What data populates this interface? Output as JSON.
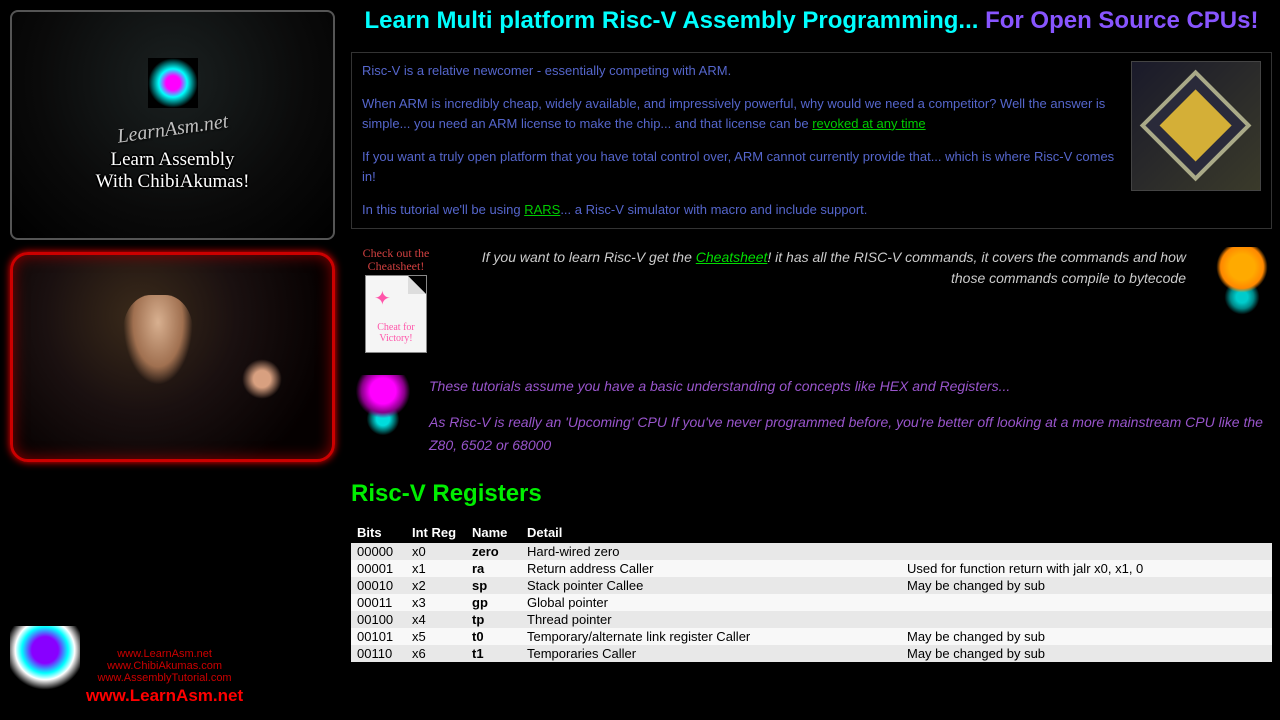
{
  "sidebar": {
    "logo_brand": "LearnAsm.net",
    "logo_tagline_1": "Learn Assembly",
    "logo_tagline_2": "With ChibiAkumas!",
    "footer_links": [
      "www.LearnAsm.net",
      "www.ChibiAkumas.com",
      "www.AssemblyTutorial.com"
    ],
    "footer_main": "www.LearnAsm.net"
  },
  "title": {
    "part1": "Learn Multi platform Risc-V Assembly Programming... ",
    "part2": "For Open Source CPUs!"
  },
  "intro": {
    "p1": "Risc-V is a relative newcomer - essentially competing with ARM.",
    "p2a": "When ARM is incredibly cheap, widely available, and impressively powerful, why would we need a competitor? Well the answer is simple... you need an ARM license to make the chip... and that license can be ",
    "p2link": "revoked at any time",
    "p3": "If you want a truly open platform that you have total control over, ARM cannot currently provide that... which is where Risc-V comes in!",
    "p4a": "In this tutorial we'll be using ",
    "p4link": "RARS",
    "p4b": "... a Risc-V simulator with macro and include support."
  },
  "cheat": {
    "label1": "Check out the",
    "label2": "Cheatsheet!",
    "doc_line1": "Cheat for",
    "doc_line2": "Victory!",
    "text_a": "If you want to learn Risc-V get the ",
    "text_link": "Cheatsheet",
    "text_b": "! it has all the RISC-V commands, it covers the commands and how those commands compile to bytecode"
  },
  "tips": {
    "p1": "These tutorials assume you have a basic understanding of concepts like HEX and Registers...",
    "p2": "As Risc-V is really an 'Upcoming' CPU If you've never programmed before, you're better off looking at a more mainstream CPU like the Z80, 6502 or 68000"
  },
  "section_title": "Risc-V Registers",
  "table": {
    "headers": [
      "Bits",
      "Int Reg",
      "Name",
      "Detail",
      ""
    ],
    "rows": [
      {
        "bits": "00000",
        "reg": "x0",
        "name": "zero",
        "detail": "Hard-wired zero",
        "note": "",
        "hl": false
      },
      {
        "bits": "00001",
        "reg": "x1",
        "name": "ra",
        "detail": "Return address Caller",
        "note": "Used for function return with jalr x0, x1, 0",
        "hl": false
      },
      {
        "bits": "00010",
        "reg": "x2",
        "name": "sp",
        "detail": "Stack pointer Callee",
        "note": "May be changed by sub",
        "hl": false
      },
      {
        "bits": "00011",
        "reg": "x3",
        "name": "gp",
        "detail": "Global pointer",
        "note": "",
        "hl": false
      },
      {
        "bits": "00100",
        "reg": "x4",
        "name": "tp",
        "detail": "Thread pointer",
        "note": "",
        "hl": false
      },
      {
        "bits": "00101",
        "reg": "x5",
        "name": "t0",
        "detail": "Temporary/alternate link register Caller",
        "note": "May be changed by sub",
        "hl": true
      },
      {
        "bits": "00110",
        "reg": "x6",
        "name": "t1",
        "detail": "Temporaries Caller",
        "note": "May be changed by sub",
        "hl": true
      }
    ]
  }
}
